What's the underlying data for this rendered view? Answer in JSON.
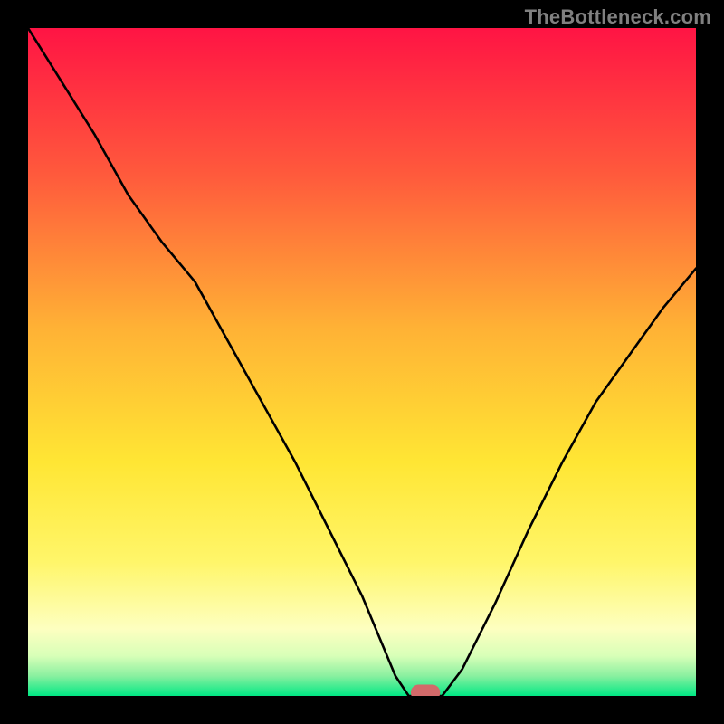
{
  "watermark": "TheBottleneck.com",
  "chart_data": {
    "type": "line",
    "title": "",
    "xlabel": "",
    "ylabel": "",
    "xlim": [
      0,
      100
    ],
    "ylim": [
      0,
      100
    ],
    "x": [
      0,
      5,
      10,
      15,
      20,
      25,
      30,
      35,
      40,
      45,
      50,
      55,
      57,
      60,
      62,
      65,
      70,
      75,
      80,
      85,
      90,
      95,
      100
    ],
    "values": [
      100,
      92,
      84,
      75,
      68,
      62,
      53,
      44,
      35,
      25,
      15,
      3,
      0,
      0,
      0,
      4,
      14,
      25,
      35,
      44,
      51,
      58,
      64
    ],
    "background": {
      "type": "vertical-gradient",
      "stops": [
        {
          "pos": 0.0,
          "color": "#ff1444"
        },
        {
          "pos": 0.22,
          "color": "#ff5a3c"
        },
        {
          "pos": 0.45,
          "color": "#ffb235"
        },
        {
          "pos": 0.65,
          "color": "#ffe634"
        },
        {
          "pos": 0.8,
          "color": "#fff66a"
        },
        {
          "pos": 0.9,
          "color": "#fdffc0"
        },
        {
          "pos": 0.94,
          "color": "#d8ffb8"
        },
        {
          "pos": 0.97,
          "color": "#8af0a0"
        },
        {
          "pos": 1.0,
          "color": "#00e884"
        }
      ]
    },
    "curve_color": "#000000",
    "marker": {
      "x": 59.5,
      "y": 0.5,
      "rx": 2.2,
      "ry": 1.2,
      "color": "#d26a6a"
    }
  },
  "layout": {
    "outer_size": 800,
    "inner_margin": 31,
    "inner_size": 738
  }
}
